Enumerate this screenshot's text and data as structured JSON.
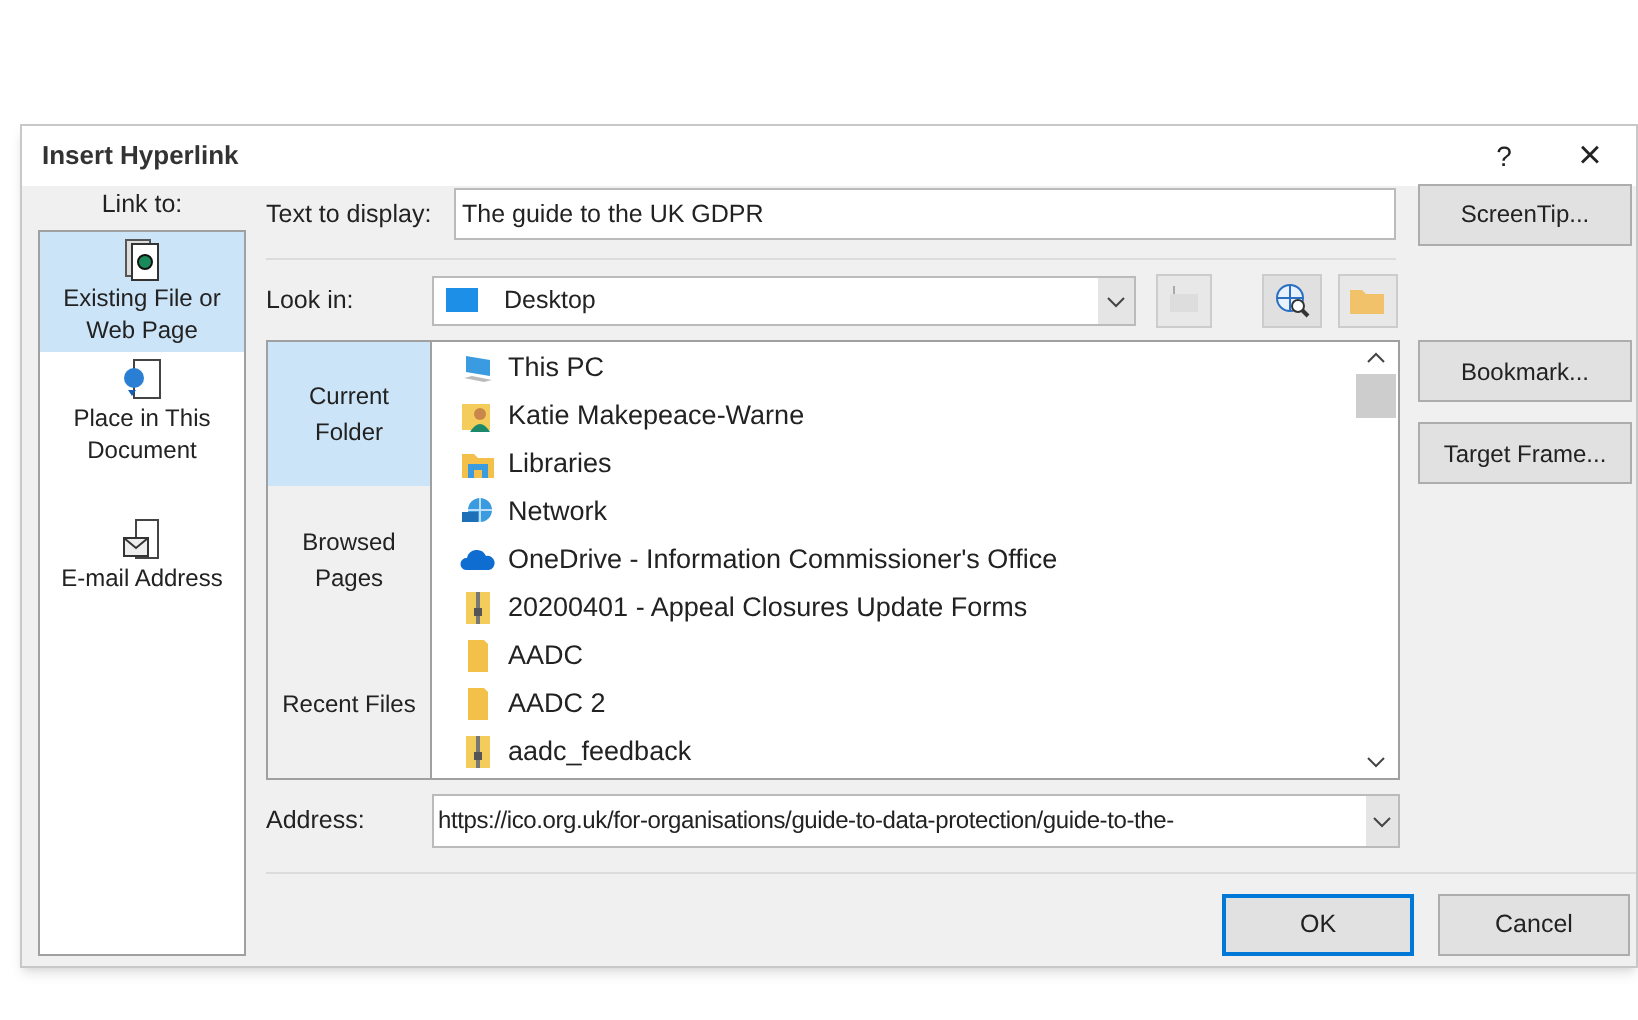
{
  "window": {
    "title": "Insert Hyperlink",
    "help": "?",
    "close": "×"
  },
  "link_to": {
    "label": "Link to:",
    "items": [
      {
        "label": "Existing File or Web Page",
        "kind": "file",
        "selected": true
      },
      {
        "label": "Place in This Document",
        "kind": "place",
        "selected": false
      },
      {
        "label": "E-mail Address",
        "kind": "email",
        "selected": false
      }
    ]
  },
  "text_to_display": {
    "label": "Text to display:",
    "value": "The guide to the UK GDPR"
  },
  "screentip_button": "ScreenTip...",
  "look_in": {
    "label": "Look in:",
    "value": "Desktop"
  },
  "browse_tabs": [
    {
      "label": "Current Folder",
      "selected": true
    },
    {
      "label": "Browsed Pages",
      "selected": false
    },
    {
      "label": "Recent Files",
      "selected": false
    }
  ],
  "files": [
    {
      "name": "This PC",
      "kind": "computer"
    },
    {
      "name": "Katie Makepeace-Warne",
      "kind": "user"
    },
    {
      "name": "Libraries",
      "kind": "libraries"
    },
    {
      "name": "Network",
      "kind": "network"
    },
    {
      "name": "OneDrive - Information Commissioner's Office",
      "kind": "cloud"
    },
    {
      "name": "20200401 - Appeal Closures Update Forms",
      "kind": "zip"
    },
    {
      "name": "AADC",
      "kind": "folder"
    },
    {
      "name": "AADC 2",
      "kind": "folder"
    },
    {
      "name": "aadc_feedback",
      "kind": "zip"
    }
  ],
  "side_buttons": [
    "Bookmark...",
    "Target Frame..."
  ],
  "address": {
    "label": "Address:",
    "value": "https://ico.org.uk/for-organisations/guide-to-data-protection/guide-to-the-"
  },
  "buttons": [
    {
      "label": "OK",
      "kind": "default"
    },
    {
      "label": "Cancel",
      "kind": "normal"
    }
  ]
}
